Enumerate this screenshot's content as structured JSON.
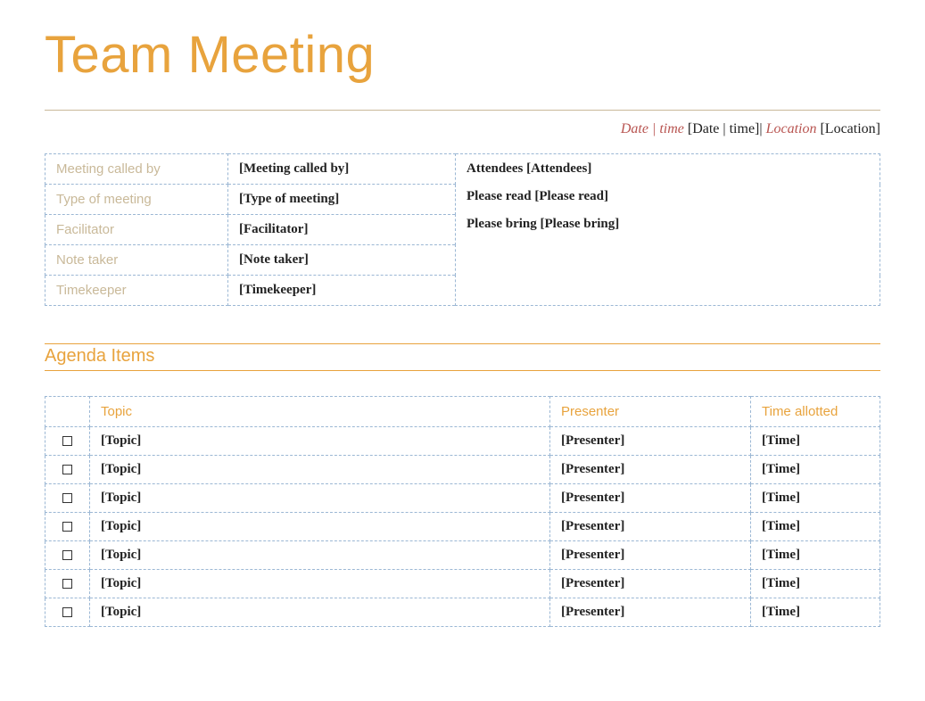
{
  "title": "Team Meeting",
  "header": {
    "datetime_label": "Date | time",
    "datetime_value": "[Date | time]",
    "location_label": "Location",
    "location_value": "[Location]"
  },
  "info": {
    "left_labels": {
      "called_by": "Meeting called by",
      "type": "Type of meeting",
      "facilitator": "Facilitator",
      "note_taker": "Note taker",
      "timekeeper": "Timekeeper"
    },
    "left_values": {
      "called_by": "[Meeting called by]",
      "type": "[Type of meeting]",
      "facilitator": "[Facilitator]",
      "note_taker": "[Note taker]",
      "timekeeper": "[Timekeeper]"
    },
    "right": {
      "attendees": "Attendees [Attendees]",
      "please_read": "Please read [Please read]",
      "please_bring": "Please bring [Please bring]"
    }
  },
  "agenda_heading": "Agenda Items",
  "agenda_headers": {
    "topic": "Topic",
    "presenter": "Presenter",
    "time": "Time allotted"
  },
  "agenda_rows": [
    {
      "topic": "[Topic]",
      "presenter": "[Presenter]",
      "time": "[Time]"
    },
    {
      "topic": "[Topic]",
      "presenter": "[Presenter]",
      "time": "[Time]"
    },
    {
      "topic": "[Topic]",
      "presenter": "[Presenter]",
      "time": "[Time]"
    },
    {
      "topic": "[Topic]",
      "presenter": "[Presenter]",
      "time": "[Time]"
    },
    {
      "topic": "[Topic]",
      "presenter": "[Presenter]",
      "time": "[Time]"
    },
    {
      "topic": "[Topic]",
      "presenter": "[Presenter]",
      "time": "[Time]"
    },
    {
      "topic": "[Topic]",
      "presenter": "[Presenter]",
      "time": "[Time]"
    }
  ]
}
